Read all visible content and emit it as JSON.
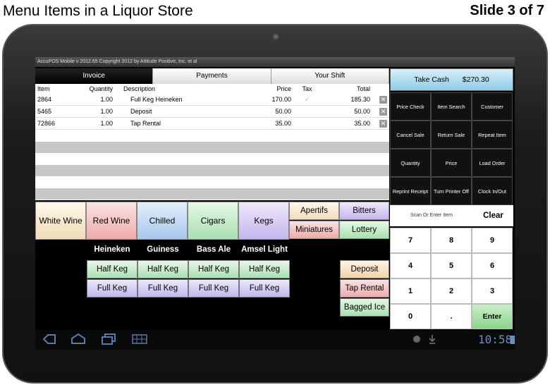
{
  "slide": {
    "title": "Menu Items in a Liquor Store",
    "number": "Slide 3 of 7"
  },
  "app": {
    "topbar": "AccuPOS Mobile v 2012.65 Copyright 2012 by Attitude Positive, Inc. et al"
  },
  "tabs": [
    {
      "label": "Invoice"
    },
    {
      "label": "Payments"
    },
    {
      "label": "Your Shift"
    }
  ],
  "table": {
    "headers": {
      "item": "Item",
      "quantity": "Quantity",
      "description": "Description",
      "price": "Price",
      "tax": "Tax",
      "total": "Total"
    },
    "rows": [
      {
        "item": "2864",
        "quantity": "1.00",
        "description": "Full Keg Heineken",
        "price": "170.00",
        "tax": "✓",
        "total": "185.30"
      },
      {
        "item": "5465",
        "quantity": "1.00",
        "description": "Deposit",
        "price": "50.00",
        "tax": "",
        "total": "50.00"
      },
      {
        "item": "72866",
        "quantity": "1.00",
        "description": "Tap Rental",
        "price": "35.00",
        "tax": "",
        "total": "35.00"
      }
    ],
    "remove_glyph": "✕"
  },
  "categories": [
    {
      "label": "White Wine",
      "color": "#f8ecd6"
    },
    {
      "label": "Red Wine",
      "color": "#f6c2c2"
    },
    {
      "label": "Chilled",
      "color": "#c6dcf4"
    },
    {
      "label": "Cigars",
      "color": "#c8eccb"
    },
    {
      "label": "Kegs",
      "color": "#dcd0f4"
    }
  ],
  "categories_small": [
    {
      "label": "Apertifs",
      "color": "#f8ecd6"
    },
    {
      "label": "Bitters",
      "color": "#dcd0f4"
    },
    {
      "label": "Miniatures",
      "color": "#f6c2c2"
    },
    {
      "label": "Lottery",
      "color": "#c8eccb"
    }
  ],
  "kegs": {
    "brands": [
      "Heineken",
      "Guiness",
      "Bass Ale",
      "Amsel Light"
    ],
    "half_label": "Half Keg",
    "full_label": "Full Keg"
  },
  "side_buttons": [
    {
      "label": "Deposit",
      "color": "#f8e4c8"
    },
    {
      "label": "Tap Rental",
      "color": "#f4c0c0"
    },
    {
      "label": "Bagged Ice",
      "color": "#c8eccb"
    }
  ],
  "take_cash": {
    "label": "Take Cash",
    "amount": "$270.30"
  },
  "functions": [
    "Price Check",
    "Item Search",
    "Customer",
    "Cancel Sale",
    "Return Sale",
    "Repeat Item",
    "Quantity",
    "Price",
    "Load Order",
    "Reprint Receipt",
    "Turn Printer Off",
    "Clock In/Out"
  ],
  "scan": {
    "placeholder": "Scan Or Enter Item",
    "clear": "Clear"
  },
  "keypad": [
    "7",
    "8",
    "9",
    "4",
    "5",
    "6",
    "1",
    "2",
    "3",
    "0",
    ".",
    "Enter"
  ],
  "status": {
    "time": "10:58"
  }
}
